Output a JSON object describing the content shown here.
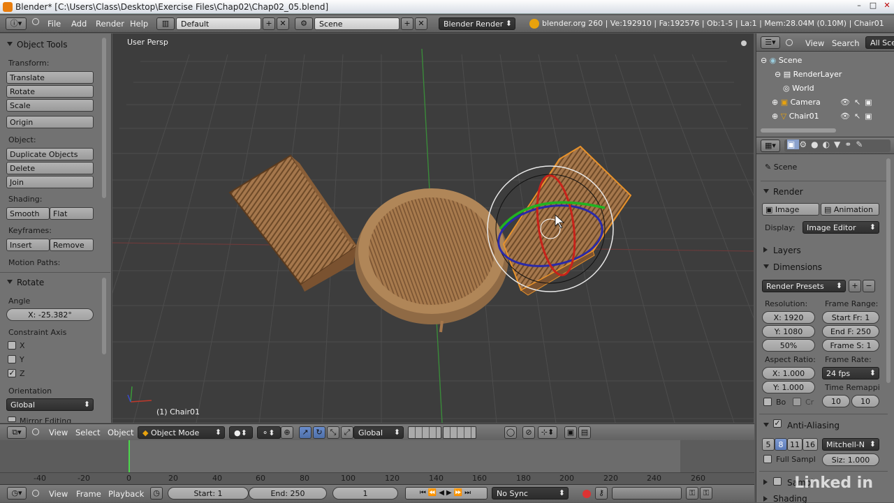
{
  "window": {
    "title": "Blender* [C:\\Users\\Class\\Desktop\\Exercise Files\\Chap02\\Chap02_05.blend]",
    "minimize": "–",
    "maximize": "□",
    "close": "✕"
  },
  "infobar": {
    "menus": [
      "File",
      "Add",
      "Render",
      "Help"
    ],
    "layout": "Default",
    "scene": "Scene",
    "engine": "Blender Render",
    "stats": "blender.org 260 | Ve:192910 | Fa:192576 | Ob:1-5 | La:1 | Mem:28.04M (0.10M) | Chair01"
  },
  "toolshelf": {
    "header": "Object Tools",
    "transform_label": "Transform:",
    "translate": "Translate",
    "rotate": "Rotate",
    "scale": "Scale",
    "origin": "Origin",
    "object_label": "Object:",
    "duplicate": "Duplicate Objects",
    "delete": "Delete",
    "join": "Join",
    "shading_label": "Shading:",
    "smooth": "Smooth",
    "flat": "Flat",
    "keyframes_label": "Keyframes:",
    "insert": "Insert",
    "remove": "Remove",
    "motion_paths_label": "Motion Paths:",
    "operator_header": "Rotate",
    "angle_label": "Angle",
    "angle_value": "X: -25.382°",
    "constraint_label": "Constraint Axis",
    "axis_x": "X",
    "axis_y": "Y",
    "axis_z": "Z",
    "orientation_label": "Orientation",
    "orientation_value": "Global",
    "mirror_editing": "Mirror Editing"
  },
  "viewport": {
    "view_name": "User Persp",
    "object_label": "(1) Chair01"
  },
  "viewport_header": {
    "view": "View",
    "select": "Select",
    "object": "Object",
    "mode": "Object Mode",
    "orientation": "Global"
  },
  "timeline": {
    "ticks": [
      "-40",
      "-20",
      "0",
      "20",
      "40",
      "60",
      "80",
      "100",
      "120",
      "140",
      "160",
      "180",
      "200",
      "220",
      "240",
      "260"
    ],
    "view": "View",
    "frame": "Frame",
    "playback": "Playback",
    "start": "Start: 1",
    "end": "End: 250",
    "current": "1",
    "sync": "No Sync"
  },
  "outliner": {
    "view": "View",
    "search": "Search",
    "filter": "All Sce",
    "items": [
      "Scene",
      "RenderLayer",
      "World",
      "Camera",
      "Chair01"
    ]
  },
  "properties": {
    "context": "Scene",
    "render_header": "Render",
    "image_btn": "Image",
    "animation_btn": "Animation",
    "display_label": "Display:",
    "display_value": "Image Editor",
    "layers_header": "Layers",
    "dimensions_header": "Dimensions",
    "render_presets": "Render Presets",
    "resolution_label": "Resolution:",
    "res_x": "X: 1920",
    "res_y": "Y: 1080",
    "res_pct": "50%",
    "frame_range_label": "Frame Range:",
    "start_fr": "Start Fr: 1",
    "end_fr": "End F: 250",
    "frame_step": "Frame S: 1",
    "aspect_label": "Aspect Ratio:",
    "asp_x": "X: 1.000",
    "asp_y": "Y: 1.000",
    "frame_rate_label": "Frame Rate:",
    "fps": "24 fps",
    "time_remap": "Time Remappi",
    "bo": "Bo",
    "cr": "Cr",
    "remap_old": "10",
    "remap_new": "10",
    "aa_header": "Anti-Aliasing",
    "aa_samples": [
      "5",
      "8",
      "11",
      "16"
    ],
    "aa_filter": "Mitchell-N",
    "full_sample": "Full Sampl",
    "filter_size": "Siz: 1.000",
    "sampled_header": "Sampl",
    "shading_header": "Shading"
  },
  "colors": {
    "blender_orange": "#e87d0d",
    "x_axis": "#c0392b",
    "y_axis": "#3a9a3a",
    "z_axis": "#3a4acc",
    "wood": "#a5774c"
  },
  "branding": {
    "watermark": "Linked in"
  }
}
